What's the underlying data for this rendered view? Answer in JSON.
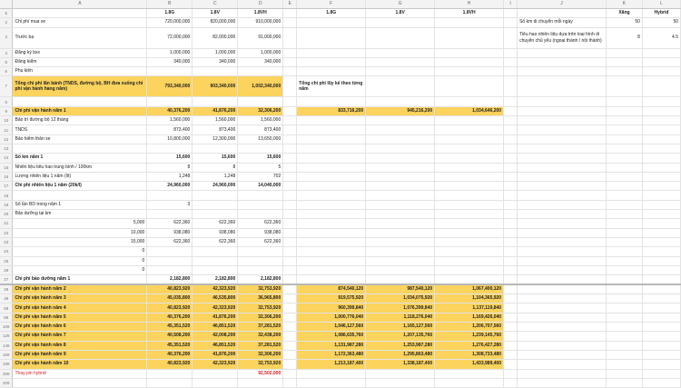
{
  "columns": [
    "A",
    "B",
    "C",
    "D",
    "E",
    "F",
    "G",
    "H",
    "I",
    "J",
    "K",
    "L"
  ],
  "rows": [
    {
      "n": "1",
      "cells": [
        "",
        "1.8G",
        "1.8V",
        "1.8VH",
        "",
        "1.8G",
        "1.8V",
        "1.8VH",
        "",
        "",
        "Xăng",
        "Hybrid"
      ]
    },
    {
      "n": "2",
      "cells": [
        "Chi phí mua xe",
        "720,000,000",
        "820,000,000",
        "910,000,000",
        "",
        "",
        "",
        "",
        "",
        "Số km di chuyển mỗi ngày",
        "50",
        "50"
      ]
    },
    {
      "n": "3",
      "cells": [
        "Trước bạ",
        "72,000,000",
        "82,000,000",
        "91,000,000",
        "",
        "",
        "",
        "",
        "",
        "Tiêu hao nhiên liệu dựa trên loại hình di chuyển chủ yếu (ngoại thành / nội thành)",
        "8",
        "4.5"
      ]
    },
    {
      "n": "4",
      "cells": [
        "Đăng ký bsx",
        "1,000,000",
        "1,000,000",
        "1,000,000",
        "",
        "",
        "",
        "",
        "",
        "",
        "",
        ""
      ]
    },
    {
      "n": "5",
      "cells": [
        "Đăng kiểm",
        "340,000",
        "340,000",
        "340,000",
        "",
        "",
        "",
        "",
        "",
        "",
        "",
        ""
      ]
    },
    {
      "n": "6",
      "cells": [
        "Phụ kiện",
        "",
        "",
        "",
        "",
        "",
        "",
        "",
        "",
        "",
        "",
        ""
      ]
    },
    {
      "n": "7",
      "cells": [
        "Tổng chi phí lăn bánh (TNDS, đường bộ, BH đưa xuống chi phí vận hành hàng năm)",
        "793,340,000",
        "903,340,000",
        "1,002,340,000",
        "",
        "Tổng chi phí lũy kế theo từng năm",
        "",
        "",
        "",
        "",
        "",
        ""
      ]
    },
    {
      "n": "8",
      "cells": [
        "",
        "",
        "",
        "",
        "",
        "",
        "",
        "",
        "",
        "",
        "",
        ""
      ]
    },
    {
      "n": "9",
      "cells": [
        "Chi phí vận hành năm 1",
        "40,376,200",
        "41,876,200",
        "32,306,200",
        "",
        "833,716,200",
        "945,216,200",
        "1,034,646,200",
        "",
        "",
        "",
        ""
      ]
    },
    {
      "n": "10",
      "cells": [
        "Bảo trì đường bộ 12 tháng",
        "1,560,000",
        "1,560,000",
        "1,560,000",
        "",
        "",
        "",
        "",
        "",
        "",
        "",
        ""
      ]
    },
    {
      "n": "11",
      "cells": [
        "TNDS",
        "873,400",
        "873,400",
        "873,400",
        "",
        "",
        "",
        "",
        "",
        "",
        "",
        ""
      ]
    },
    {
      "n": "12",
      "cells": [
        "Bảo hiểm thân xe",
        "10,800,000",
        "12,300,000",
        "13,650,000",
        "",
        "",
        "",
        "",
        "",
        "",
        "",
        ""
      ]
    },
    {
      "n": "13",
      "cells": [
        "",
        "",
        "",
        "",
        "",
        "",
        "",
        "",
        "",
        "",
        "",
        ""
      ]
    },
    {
      "n": "14",
      "cells": [
        "Số km năm 1",
        "15,600",
        "15,600",
        "15,600",
        "",
        "",
        "",
        "",
        "",
        "",
        "",
        ""
      ]
    },
    {
      "n": "15",
      "cells": [
        "Nhiên liệu tiêu hao trung bình / 100km",
        "8",
        "8",
        "5",
        "",
        "",
        "",
        "",
        "",
        "",
        "",
        ""
      ]
    },
    {
      "n": "16",
      "cells": [
        "Lượng nhiên liệu 1 năm (lít)",
        "1,248",
        "1,248",
        "702",
        "",
        "",
        "",
        "",
        "",
        "",
        "",
        ""
      ]
    },
    {
      "n": "17",
      "cells": [
        "Chi phí nhiên liệu 1 năm (20k/l)",
        "24,960,000",
        "24,960,000",
        "14,040,000",
        "",
        "",
        "",
        "",
        "",
        "",
        "",
        ""
      ]
    },
    {
      "n": "18",
      "cells": [
        "",
        "",
        "",
        "",
        "",
        "",
        "",
        "",
        "",
        "",
        "",
        ""
      ]
    },
    {
      "n": "19",
      "cells": [
        "Số lần BD trong năm 1",
        "3",
        "",
        "",
        "",
        "",
        "",
        "",
        "",
        "",
        "",
        ""
      ]
    },
    {
      "n": "20",
      "cells": [
        "Bảo dưỡng tại km",
        "",
        "",
        "",
        "",
        "",
        "",
        "",
        "",
        "",
        "",
        ""
      ]
    },
    {
      "n": "21",
      "cells": [
        "5,000",
        "622,360",
        "622,360",
        "622,360",
        "",
        "",
        "",
        "",
        "",
        "",
        "",
        ""
      ]
    },
    {
      "n": "22",
      "cells": [
        "10,000",
        "938,080",
        "938,080",
        "938,080",
        "",
        "",
        "",
        "",
        "",
        "",
        "",
        ""
      ]
    },
    {
      "n": "23",
      "cells": [
        "15,000",
        "622,360",
        "622,360",
        "622,360",
        "",
        "",
        "",
        "",
        "",
        "",
        "",
        ""
      ]
    },
    {
      "n": "24",
      "cells": [
        "0",
        "",
        "",
        "",
        "",
        "",
        "",
        "",
        "",
        "",
        "",
        ""
      ]
    },
    {
      "n": "25",
      "cells": [
        "0",
        "",
        "",
        "",
        "",
        "",
        "",
        "",
        "",
        "",
        "",
        ""
      ]
    },
    {
      "n": "26",
      "cells": [
        "0",
        "",
        "",
        "",
        "",
        "",
        "",
        "",
        "",
        "",
        "",
        ""
      ]
    },
    {
      "n": "27",
      "cells": [
        "Chi phí bảo dưỡng năm 1",
        "2,182,800",
        "2,182,800",
        "2,182,800",
        "",
        "",
        "",
        "",
        "",
        "",
        "",
        ""
      ]
    },
    {
      "n": "28",
      "cells": [
        "Chi phí vận hành năm 2",
        "40,823,920",
        "42,323,920",
        "32,753,920",
        "",
        "874,540,120",
        "987,540,120",
        "1,067,400,120",
        "",
        "",
        "",
        ""
      ]
    },
    {
      "n": "49",
      "cells": [
        "Chi phí vận hành năm 3",
        "45,035,800",
        "46,535,800",
        "36,965,800",
        "",
        "919,575,920",
        "1,034,075,920",
        "1,104,365,920",
        "",
        "",
        "",
        ""
      ]
    },
    {
      "n": "69",
      "cells": [
        "Chi phí vận hành năm 4",
        "40,823,920",
        "42,323,920",
        "32,753,920",
        "",
        "960,399,840",
        "1,076,399,840",
        "1,137,119,840",
        "",
        "",
        "",
        ""
      ]
    },
    {
      "n": "89",
      "cells": [
        "Chi phí vận hành năm 5",
        "40,376,200",
        "41,876,200",
        "32,306,200",
        "",
        "1,000,776,040",
        "1,118,276,040",
        "1,169,426,040",
        "",
        "",
        "",
        ""
      ]
    },
    {
      "n": "109",
      "cells": [
        "Chi phí vận hành năm 6",
        "45,351,520",
        "46,851,520",
        "37,281,520",
        "",
        "1,046,127,560",
        "1,165,127,560",
        "1,206,707,560",
        "",
        "",
        "",
        ""
      ]
    },
    {
      "n": "129",
      "cells": [
        "Chi phí vận hành năm 7",
        "40,508,200",
        "42,008,200",
        "32,438,200",
        "",
        "1,086,635,760",
        "1,207,135,760",
        "1,239,145,760",
        "",
        "",
        "",
        ""
      ]
    },
    {
      "n": "149",
      "cells": [
        "Chi phí vận hành năm 8",
        "45,351,520",
        "46,851,520",
        "37,281,520",
        "",
        "1,131,987,280",
        "1,253,987,280",
        "1,276,427,280",
        "",
        "",
        "",
        ""
      ]
    },
    {
      "n": "169",
      "cells": [
        "Chi phí vận hành năm 9",
        "40,376,200",
        "41,876,200",
        "32,306,200",
        "",
        "1,172,363,480",
        "1,295,863,480",
        "1,308,733,480",
        "",
        "",
        "",
        ""
      ]
    },
    {
      "n": "189",
      "cells": [
        "Chi phí vận hành năm 10",
        "40,823,920",
        "42,323,920",
        "32,753,920",
        "",
        "1,213,187,400",
        "1,338,187,400",
        "1,433,989,400",
        "",
        "",
        "",
        ""
      ]
    },
    {
      "n": "208",
      "cells": [
        "Thay pin hybrid",
        "",
        "",
        "92,502,000",
        "",
        "",
        "",
        "",
        "",
        "",
        "",
        ""
      ]
    },
    {
      "n": "209",
      "cells": [
        "",
        "",
        "",
        "",
        "",
        "",
        "",
        "",
        "",
        "",
        "",
        ""
      ]
    }
  ],
  "colors": {
    "highlight": "#fbd35d",
    "warning_text": "#d41f1f",
    "header_bg": "#f3f3f3"
  }
}
